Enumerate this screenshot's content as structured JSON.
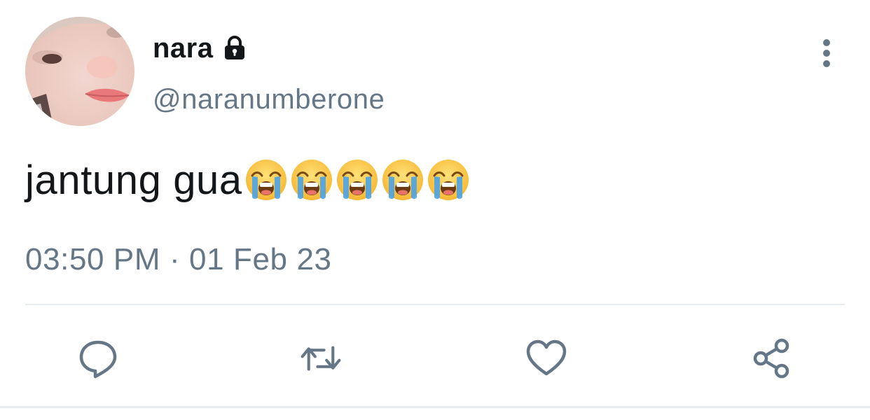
{
  "tweet": {
    "display_name": "nara",
    "handle": "@naranumberone",
    "text": "jantung gua",
    "emoji": [
      "crying-emoji",
      "crying-emoji",
      "crying-emoji",
      "crying-emoji",
      "crying-emoji"
    ],
    "timestamp": "03:50 PM · 01 Feb 23",
    "protected": true
  },
  "icons": {
    "lock": "lock-icon",
    "more": "vertical-ellipsis-icon",
    "reply": "speech-bubble-icon",
    "retweet": "retweet-arrows-icon",
    "like": "heart-icon",
    "share": "share-nodes-icon"
  },
  "colors": {
    "text_primary": "#14171a",
    "text_secondary": "#657786",
    "divider": "#e6ecf0"
  }
}
